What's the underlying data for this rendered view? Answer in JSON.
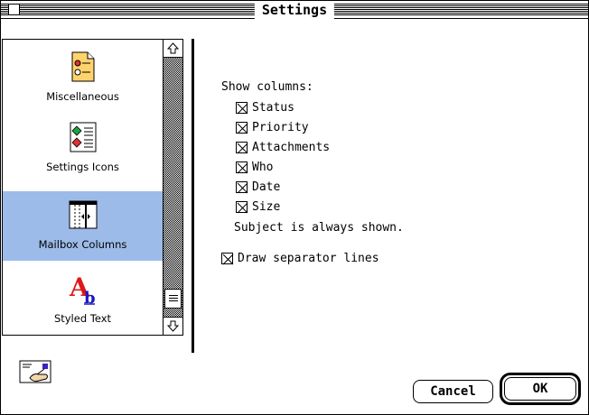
{
  "window": {
    "title": "Settings"
  },
  "sidebar": {
    "items": [
      {
        "label": "Miscellaneous",
        "icon": "miscellaneous-icon",
        "selected": false
      },
      {
        "label": "Settings Icons",
        "icon": "settings-icons-icon",
        "selected": false
      },
      {
        "label": "Mailbox Columns",
        "icon": "mailbox-columns-icon",
        "selected": true
      },
      {
        "label": "Styled Text",
        "icon": "styled-text-icon",
        "selected": false
      }
    ],
    "selected_color": "#9cbbe9"
  },
  "panel": {
    "header": "Show columns:",
    "columns": [
      {
        "label": "Status",
        "checked": true
      },
      {
        "label": "Priority",
        "checked": true
      },
      {
        "label": "Attachments",
        "checked": true
      },
      {
        "label": "Who",
        "checked": true
      },
      {
        "label": "Date",
        "checked": true
      },
      {
        "label": "Size",
        "checked": true
      }
    ],
    "note": "Subject is always shown.",
    "separator": {
      "label": "Draw separator lines",
      "checked": true
    }
  },
  "buttons": {
    "cancel": "Cancel",
    "ok": "OK"
  }
}
